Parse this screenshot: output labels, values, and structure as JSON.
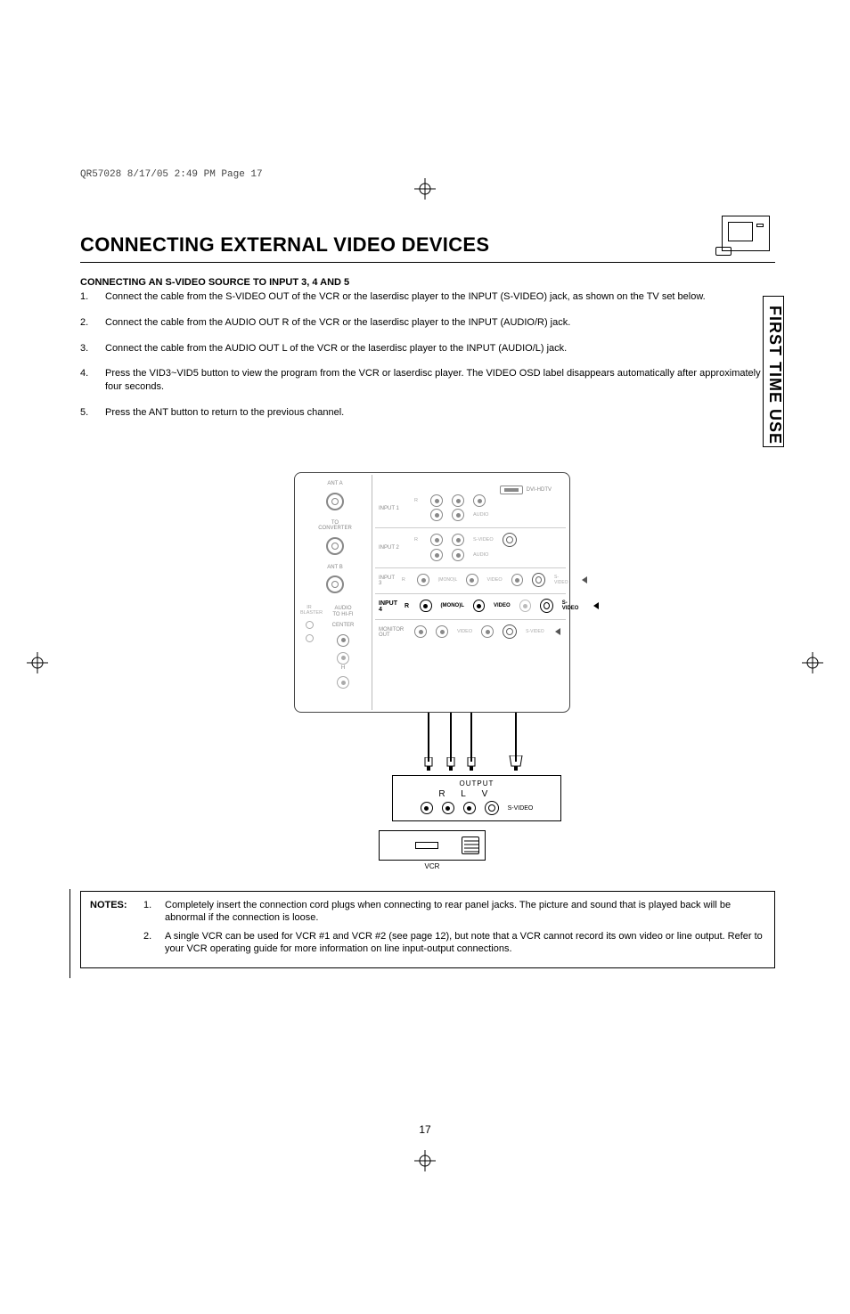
{
  "print_slug": "QR57028  8/17/05  2:49 PM  Page 17",
  "title": "CONNECTING EXTERNAL VIDEO DEVICES",
  "side_tab": "FIRST TIME USE",
  "subhead": "CONNECTING AN S-VIDEO SOURCE TO INPUT 3, 4 AND 5",
  "steps": [
    {
      "n": "1.",
      "text": "Connect the cable from the S-VIDEO OUT of the VCR or the laserdisc player to the INPUT (S-VIDEO) jack, as shown on the TV set below."
    },
    {
      "n": "2.",
      "text": "Connect the cable from the AUDIO OUT R of the VCR or the laserdisc player to the INPUT (AUDIO/R) jack."
    },
    {
      "n": "3.",
      "text": "Connect the cable from the AUDIO OUT L of the VCR or the laserdisc player to the INPUT (AUDIO/L) jack."
    },
    {
      "n": "4.",
      "text": "Press the VID3~VID5 button to view the program from the VCR or laserdisc player.  The VIDEO OSD label disappears automatically after approximately four seconds."
    },
    {
      "n": "5.",
      "text": "Press the ANT button to return to the previous channel."
    }
  ],
  "diagram": {
    "ant_a": "ANT A",
    "to_converter": "TO\nCONVERTER",
    "ant_b": "ANT B",
    "hdmi": "DVI-HDTV",
    "input1": "INPUT 1",
    "input2": "INPUT 2",
    "input3": "INPUT 3",
    "input4": "INPUT 4",
    "monitor_out": "MONITOR\nOUT",
    "audio_hifi": "AUDIO\nTO HI-FI",
    "center": "CENTER",
    "ir_blaster": "IR\nBLASTER",
    "r": "R",
    "l": "L",
    "monol": "(MONO)L",
    "audio": "AUDIO",
    "video": "VIDEO",
    "svideo_small": "S-VIDEO",
    "h": "H",
    "vcr_output": "OUTPUT",
    "vcr_r": "R",
    "vcr_l": "L",
    "vcr_v": "V",
    "vcr_svideo": "S-VIDEO",
    "vcr_caption": "VCR"
  },
  "notes_label": "NOTES:",
  "notes": [
    {
      "n": "1.",
      "text": "Completely insert the connection cord plugs when connecting to rear panel jacks.  The picture and sound that is played back will be abnormal if the connection is loose."
    },
    {
      "n": "2.",
      "text": "A single VCR can be used for VCR #1 and VCR #2 (see page 12), but note that a VCR cannot record its own video or line output.  Refer to your VCR operating guide for more information on line input-output connections."
    }
  ],
  "page_number": "17"
}
